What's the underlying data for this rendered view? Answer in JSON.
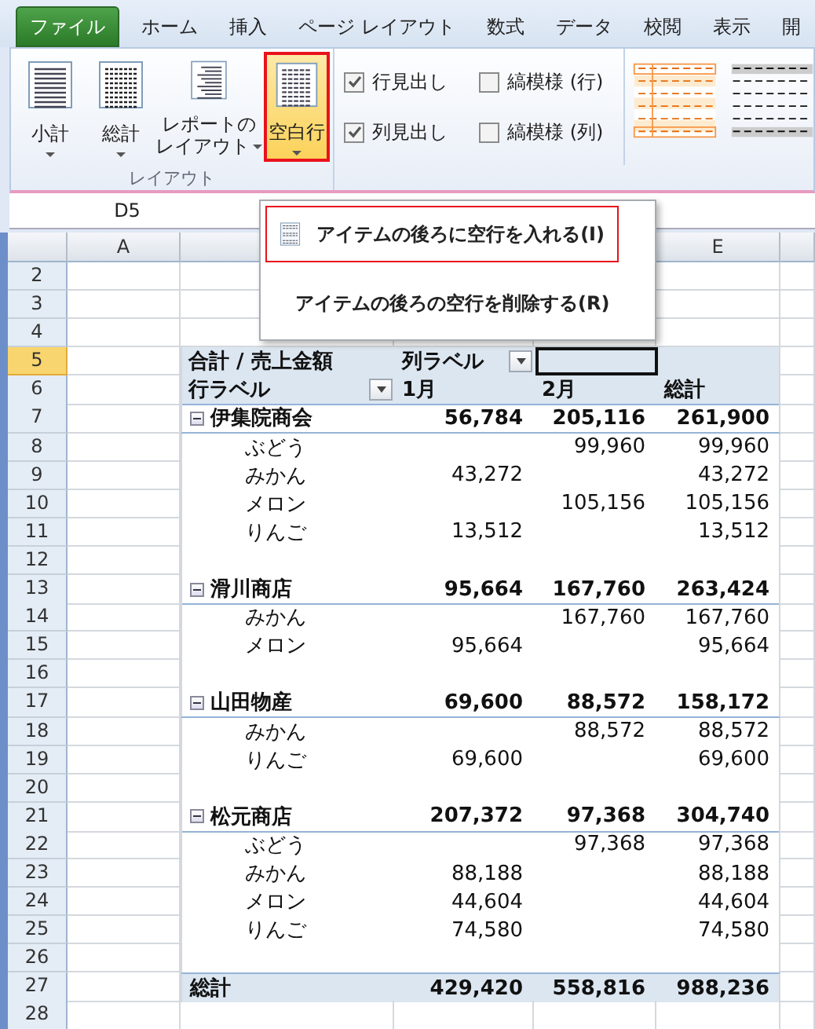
{
  "tabs": [
    {
      "label": "ファイル",
      "kind": "file"
    },
    {
      "label": "ホーム",
      "kind": "tab"
    },
    {
      "label": "挿入",
      "kind": "tab"
    },
    {
      "label": "ページ レイアウト",
      "kind": "tab"
    },
    {
      "label": "数式",
      "kind": "tab"
    },
    {
      "label": "データ",
      "kind": "tab"
    },
    {
      "label": "校閲",
      "kind": "tab"
    },
    {
      "label": "表示",
      "kind": "tab"
    },
    {
      "label": "開",
      "kind": "tab"
    }
  ],
  "ribbon": {
    "buttons": [
      {
        "lines": [
          "小計"
        ],
        "selected": false
      },
      {
        "lines": [
          "総計"
        ],
        "selected": false
      },
      {
        "lines": [
          "レポートの",
          "レイアウト"
        ],
        "selected": false
      },
      {
        "lines": [
          "空白行"
        ],
        "selected": true
      }
    ],
    "group_label": "レイアウト",
    "checkboxes": [
      {
        "label": "行見出し",
        "checked": true
      },
      {
        "label": "縞模様 (行)",
        "checked": false
      },
      {
        "label": "列見出し",
        "checked": true
      },
      {
        "label": "縞模様 (列)",
        "checked": false
      }
    ]
  },
  "menu": {
    "items": [
      {
        "label": "アイテムの後ろに空行を入れる(I)",
        "selected": true
      },
      {
        "label": "アイテムの後ろの空行を削除する(R)",
        "selected": false
      }
    ]
  },
  "name_box": "D5",
  "columns": [
    {
      "label": "A"
    },
    {
      "label": "E"
    }
  ],
  "rows": [
    {
      "num": "2",
      "kind": "sheet",
      "selected": false
    },
    {
      "num": "3",
      "kind": "sheet",
      "selected": false
    },
    {
      "num": "4",
      "kind": "sheet",
      "selected": false
    },
    {
      "num": "5",
      "kind": "title",
      "selected": true,
      "cells": [
        "合計 / 売上金額",
        "列ラベル",
        {
          "selected": true
        },
        null
      ]
    },
    {
      "num": "6",
      "kind": "header",
      "selected": false,
      "cells": [
        "行ラベル",
        "1月",
        "2月",
        "総計"
      ]
    },
    {
      "num": "7",
      "kind": "group",
      "selected": false,
      "cells": [
        "伊集院商会",
        "56,784",
        "205,116",
        "261,900"
      ]
    },
    {
      "num": "8",
      "kind": "item",
      "selected": false,
      "cells": [
        "ぶどう",
        null,
        "99,960",
        "99,960"
      ]
    },
    {
      "num": "9",
      "kind": "item",
      "selected": false,
      "cells": [
        "みかん",
        "43,272",
        null,
        "43,272"
      ]
    },
    {
      "num": "10",
      "kind": "item",
      "selected": false,
      "cells": [
        "メロン",
        null,
        "105,156",
        "105,156"
      ]
    },
    {
      "num": "11",
      "kind": "item",
      "selected": false,
      "cells": [
        "りんご",
        "13,512",
        null,
        "13,512"
      ]
    },
    {
      "num": "12",
      "kind": "gap",
      "selected": false
    },
    {
      "num": "13",
      "kind": "group",
      "selected": false,
      "cells": [
        "滑川商店",
        "95,664",
        "167,760",
        "263,424"
      ]
    },
    {
      "num": "14",
      "kind": "item",
      "selected": false,
      "cells": [
        "みかん",
        null,
        "167,760",
        "167,760"
      ]
    },
    {
      "num": "15",
      "kind": "item",
      "selected": false,
      "cells": [
        "メロン",
        "95,664",
        null,
        "95,664"
      ]
    },
    {
      "num": "16",
      "kind": "gap",
      "selected": false
    },
    {
      "num": "17",
      "kind": "group",
      "selected": false,
      "cells": [
        "山田物産",
        "69,600",
        "88,572",
        "158,172"
      ]
    },
    {
      "num": "18",
      "kind": "item",
      "selected": false,
      "cells": [
        "みかん",
        null,
        "88,572",
        "88,572"
      ]
    },
    {
      "num": "19",
      "kind": "item",
      "selected": false,
      "cells": [
        "りんご",
        "69,600",
        null,
        "69,600"
      ]
    },
    {
      "num": "20",
      "kind": "gap",
      "selected": false
    },
    {
      "num": "21",
      "kind": "group",
      "selected": false,
      "cells": [
        "松元商店",
        "207,372",
        "97,368",
        "304,740"
      ]
    },
    {
      "num": "22",
      "kind": "item",
      "selected": false,
      "cells": [
        "ぶどう",
        null,
        "97,368",
        "97,368"
      ]
    },
    {
      "num": "23",
      "kind": "item",
      "selected": false,
      "cells": [
        "みかん",
        "88,188",
        null,
        "88,188"
      ]
    },
    {
      "num": "24",
      "kind": "item",
      "selected": false,
      "cells": [
        "メロン",
        "44,604",
        null,
        "44,604"
      ]
    },
    {
      "num": "25",
      "kind": "item",
      "selected": false,
      "cells": [
        "りんご",
        "74,580",
        null,
        "74,580"
      ]
    },
    {
      "num": "26",
      "kind": "gap",
      "selected": false
    },
    {
      "num": "27",
      "kind": "total",
      "selected": false,
      "cells": [
        "総計",
        "429,420",
        "558,816",
        "988,236"
      ]
    },
    {
      "num": "28",
      "kind": "sheet",
      "selected": false
    }
  ]
}
